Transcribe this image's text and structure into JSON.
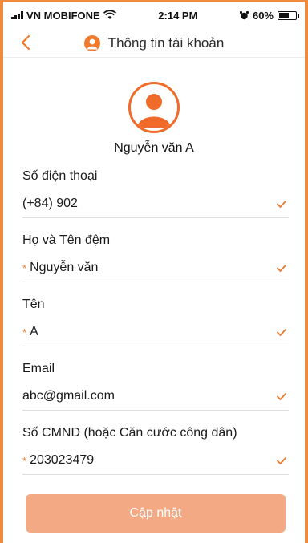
{
  "status_bar": {
    "carrier": "VN MOBIFONE",
    "time": "2:14 PM",
    "battery": "60%"
  },
  "header": {
    "title": "Thông tin tài khoản"
  },
  "profile": {
    "name": "Nguyễn văn A"
  },
  "fields": [
    {
      "label": "Số điện thoại",
      "value": "(+84) 902",
      "required": false
    },
    {
      "label": "Họ và Tên đệm",
      "value": "Nguyễn văn",
      "required": true
    },
    {
      "label": "Tên",
      "value": "A",
      "required": true
    },
    {
      "label": "Email",
      "value": "abc@gmail.com",
      "required": false
    },
    {
      "label": "Số CMND (hoặc Căn cước công dân)",
      "value": "203023479",
      "required": true
    }
  ],
  "required_mark": "*",
  "update_button": "Cập nhật",
  "colors": {
    "accent": "#f07a2b",
    "button": "#f4a985"
  },
  "icons": {
    "back": "chevron-left-icon",
    "user": "user-icon",
    "check": "check-icon",
    "wifi": "wifi-icon",
    "alarm": "alarm-icon",
    "battery": "battery-icon"
  }
}
